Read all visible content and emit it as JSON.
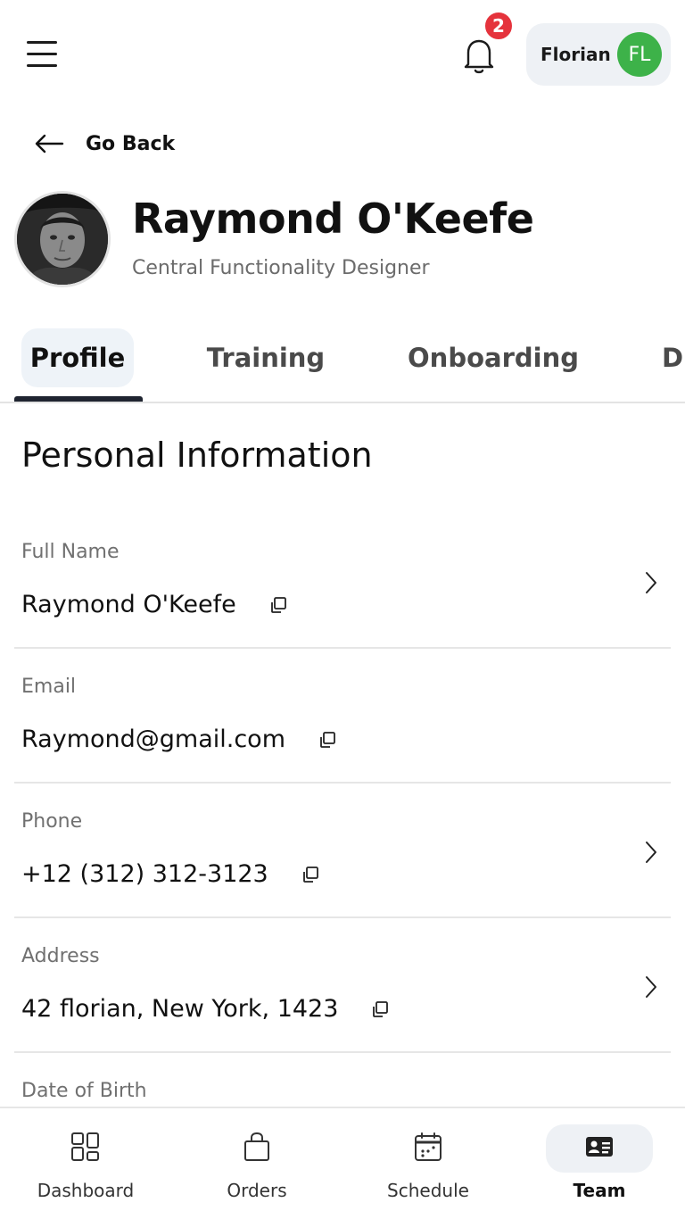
{
  "header": {
    "menu_icon": "hamburger-menu-icon",
    "notification_count": "2",
    "user_name": "Florian",
    "user_initials": "FL",
    "avatar_color": "#3db249",
    "badge_color": "#e5333c"
  },
  "navigation": {
    "go_back_label": "Go Back"
  },
  "profile": {
    "name": "Raymond O'Keefe",
    "role": "Central Functionality Designer"
  },
  "tabs": [
    {
      "label": "Profile",
      "active": true
    },
    {
      "label": "Training",
      "active": false
    },
    {
      "label": "Onboarding",
      "active": false
    },
    {
      "label": "D",
      "active": false
    }
  ],
  "section": {
    "title": "Personal Information"
  },
  "fields": [
    {
      "label": "Full Name",
      "value": "Raymond O'Keefe",
      "has_chevron": true
    },
    {
      "label": "Email",
      "value": "Raymond@gmail.com",
      "has_chevron": false
    },
    {
      "label": "Phone",
      "value": "+12 (312) 312-3123",
      "has_chevron": true
    },
    {
      "label": "Address",
      "value": "42 florian, New York, 1423",
      "has_chevron": true
    },
    {
      "label": "Date of Birth",
      "value": "",
      "has_chevron": false
    }
  ],
  "bottom_nav": [
    {
      "label": "Dashboard",
      "icon": "dashboard-icon",
      "active": false
    },
    {
      "label": "Orders",
      "icon": "shopping-bag-icon",
      "active": false
    },
    {
      "label": "Schedule",
      "icon": "calendar-icon",
      "active": false
    },
    {
      "label": "Team",
      "icon": "id-card-icon",
      "active": true
    }
  ]
}
